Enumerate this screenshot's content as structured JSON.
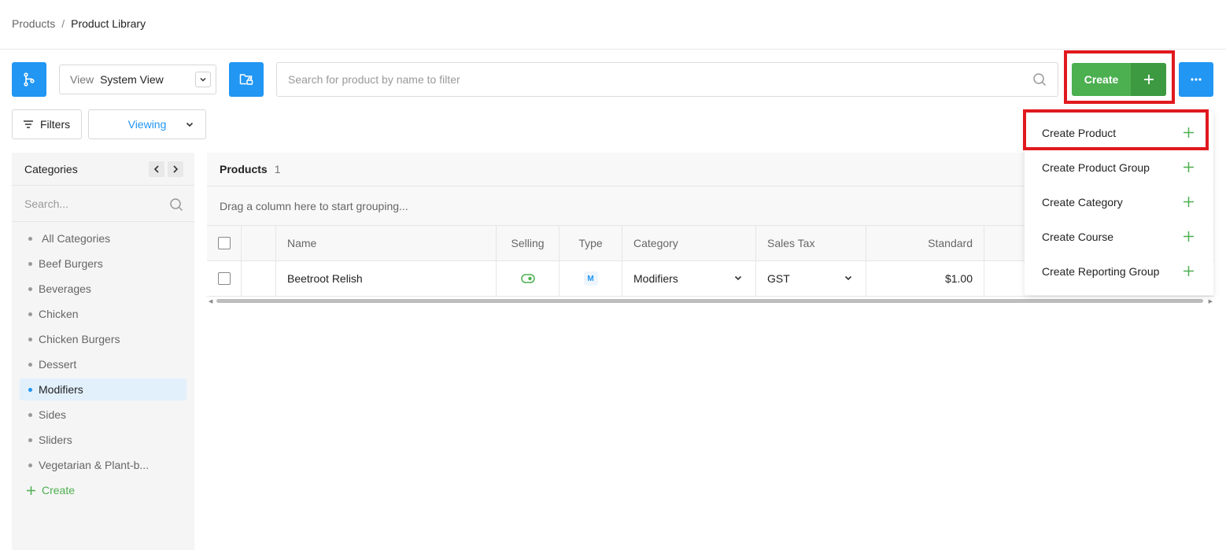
{
  "breadcrumb": {
    "root": "Products",
    "separator": "/",
    "current": "Product Library"
  },
  "toolbar": {
    "view_label": "View",
    "view_value": "System View",
    "search_placeholder": "Search for product by name to filter",
    "create_label": "Create",
    "filters_label": "Filters",
    "viewing_label": "Viewing"
  },
  "colors": {
    "primary": "#2196f3",
    "success": "#4caf50",
    "highlight": "#e0191e"
  },
  "sidebar": {
    "title": "Categories",
    "search_placeholder": "Search...",
    "items": [
      {
        "label": "All Categories"
      },
      {
        "label": "Beef Burgers"
      },
      {
        "label": "Beverages"
      },
      {
        "label": "Chicken"
      },
      {
        "label": "Chicken Burgers"
      },
      {
        "label": "Dessert"
      },
      {
        "label": "Modifiers"
      },
      {
        "label": "Sides"
      },
      {
        "label": "Sliders"
      },
      {
        "label": "Vegetarian & Plant-b..."
      }
    ],
    "create_label": "Create"
  },
  "grid": {
    "title": "Products",
    "count": "1",
    "group_hint": "Drag a column here to start grouping...",
    "columns": {
      "name": "Name",
      "selling": "Selling",
      "type": "Type",
      "category": "Category",
      "sales_tax": "Sales Tax",
      "standard": "Standard"
    },
    "rows": [
      {
        "name": "Beetroot Relish",
        "type": "M",
        "category": "Modifiers",
        "sales_tax": "GST",
        "standard": "$1.00"
      }
    ]
  },
  "create_menu": {
    "items": [
      {
        "label": "Create Product"
      },
      {
        "label": "Create Product Group"
      },
      {
        "label": "Create Category"
      },
      {
        "label": "Create Course"
      },
      {
        "label": "Create Reporting Group"
      }
    ]
  }
}
